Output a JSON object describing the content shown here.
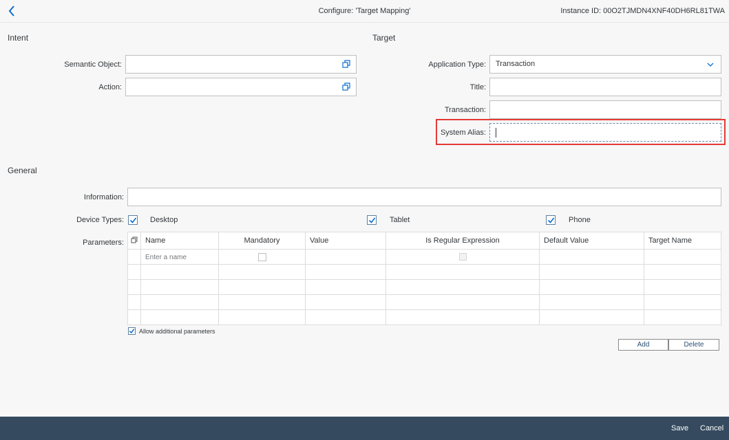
{
  "header": {
    "title": "Configure: 'Target Mapping'",
    "instance_id": "Instance ID: 00O2TJMDN4XNF40DH6RL81TWA"
  },
  "intent": {
    "section_title": "Intent",
    "semantic_object_label": "Semantic Object:",
    "semantic_object_value": "",
    "action_label": "Action:",
    "action_value": ""
  },
  "target": {
    "section_title": "Target",
    "application_type_label": "Application Type:",
    "application_type_value": "Transaction",
    "title_label": "Title:",
    "title_value": "",
    "transaction_label": "Transaction:",
    "transaction_value": "",
    "system_alias_label": "System Alias:",
    "system_alias_value": ""
  },
  "general": {
    "section_title": "General",
    "information_label": "Information:",
    "information_value": "",
    "device_types_label": "Device Types:",
    "devices": [
      {
        "label": "Desktop",
        "checked": true
      },
      {
        "label": "Tablet",
        "checked": true
      },
      {
        "label": "Phone",
        "checked": true
      }
    ],
    "parameters_label": "Parameters:",
    "columns": [
      "Name",
      "Mandatory",
      "Value",
      "Is Regular Expression",
      "Default Value",
      "Target Name"
    ],
    "first_row_placeholder": "Enter a name",
    "allow_additional_label": "Allow additional parameters",
    "allow_additional_checked": true,
    "add_label": "Add",
    "delete_label": "Delete"
  },
  "footer": {
    "save_label": "Save",
    "cancel_label": "Cancel"
  },
  "colors": {
    "footer_bg": "#354a5f",
    "highlight": "#e53935",
    "accent": "#0a6ed1"
  }
}
